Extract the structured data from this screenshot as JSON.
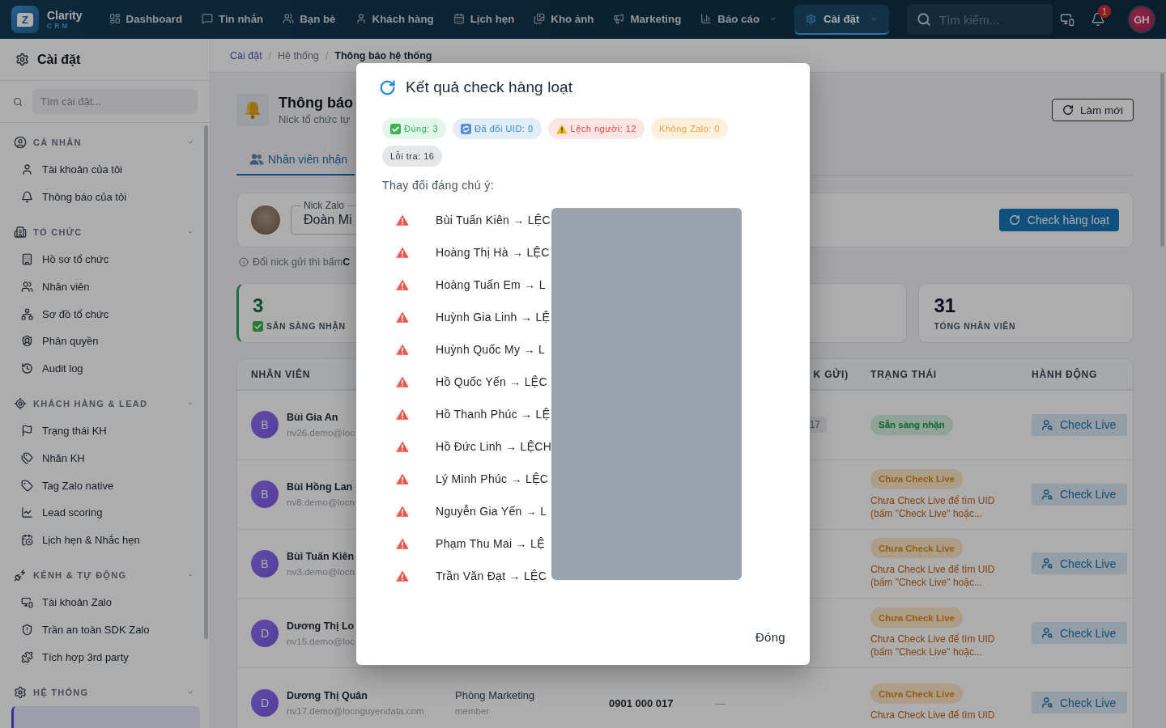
{
  "topbar": {
    "logo": {
      "mark": "Z",
      "name": "Clarity",
      "tagline": "CRM"
    },
    "nav": [
      {
        "label": "Dashboard",
        "selected": false,
        "has_menu": false
      },
      {
        "label": "Tin nhắn",
        "selected": false,
        "has_menu": false
      },
      {
        "label": "Bạn bè",
        "selected": false,
        "has_menu": false
      },
      {
        "label": "Khách hàng",
        "selected": false,
        "has_menu": false
      },
      {
        "label": "Lịch hẹn",
        "selected": false,
        "has_menu": false
      },
      {
        "label": "Kho ảnh",
        "selected": false,
        "has_menu": false
      },
      {
        "label": "Marketing",
        "selected": false,
        "has_menu": false
      },
      {
        "label": "Báo cáo",
        "selected": false,
        "has_menu": true
      },
      {
        "label": "Cài đặt",
        "selected": true,
        "has_menu": true
      }
    ],
    "search": {
      "placeholder": "Tìm kiếm..."
    },
    "notifications": {
      "badge": "1"
    },
    "avatar": {
      "initials": "GH"
    }
  },
  "sidebar": {
    "title": "Cài đặt",
    "search": {
      "placeholder": "Tìm cài đặt..."
    },
    "groups": [
      {
        "label": "CÁ NHÂN",
        "expanded": true,
        "items": [
          {
            "label": "Tài khoản của tôi",
            "selected": false
          },
          {
            "label": "Thông báo của tôi",
            "selected": false
          }
        ]
      },
      {
        "label": "TỔ CHỨC",
        "expanded": true,
        "items": [
          {
            "label": "Hồ sơ tổ chức",
            "selected": false
          },
          {
            "label": "Nhân viên",
            "selected": false
          },
          {
            "label": "Sơ đồ tổ chức",
            "selected": false
          },
          {
            "label": "Phân quyền",
            "selected": false
          },
          {
            "label": "Audit log",
            "selected": false
          }
        ]
      },
      {
        "label": "KHÁCH HÀNG & LEAD",
        "expanded": true,
        "items": [
          {
            "label": "Trạng thái KH",
            "selected": false
          },
          {
            "label": "Nhãn KH",
            "selected": false
          },
          {
            "label": "Tag Zalo native",
            "selected": false
          },
          {
            "label": "Lead scoring",
            "selected": false
          },
          {
            "label": "Lịch hẹn & Nhắc hẹn",
            "selected": false
          }
        ]
      },
      {
        "label": "KÊNH & TỰ ĐỘNG",
        "expanded": true,
        "items": [
          {
            "label": "Tài khoản Zalo",
            "selected": false
          },
          {
            "label": "Trần an toàn SDK Zalo",
            "selected": false
          },
          {
            "label": "Tích hợp 3rd party",
            "selected": false
          }
        ]
      },
      {
        "label": "HỆ THỐNG",
        "expanded": true,
        "items": [
          {
            "selected": true
          }
        ]
      }
    ]
  },
  "breadcrumb": [
    {
      "label": "Cài đặt",
      "kind": "link"
    },
    {
      "label": "/",
      "kind": "separator"
    },
    {
      "label": "Hệ thống",
      "kind": "crumb"
    },
    {
      "label": "/",
      "kind": "separator"
    },
    {
      "label": "Thông báo hệ thống",
      "kind": "current"
    }
  ],
  "page_header": {
    "title": "Thông báo",
    "subtitle": "Nick tổ chức tự",
    "refresh_button": "Làm mới"
  },
  "tabs": [
    {
      "label": "Nhân viên nhận",
      "selected": true
    }
  ],
  "sender_card": {
    "field_label": "Nick Zalo",
    "field_value": "Đoàn Mi",
    "check_button": "Check hàng loạt"
  },
  "hint": "Đổi nick gửi thì bấm**C**",
  "stat_cards": [
    {
      "kind": "ready",
      "value": "3",
      "label": "SẴN SÀNG NHẬN"
    },
    {
      "kind": "covered"
    },
    {
      "kind": "total",
      "value": "31",
      "label": "TỔNG NHÂN VIÊN"
    }
  ],
  "table": {
    "columns": [
      "NHÂN VIÊN",
      null,
      null,
      "K GỬI)",
      "TRẠNG THÁI",
      "HÀNH ĐỘNG"
    ],
    "rows": [
      {
        "avatar": "B",
        "name": "Bùi Gia An",
        "email": "nv26.demo@loc",
        "nick_badge": "17",
        "status": {
          "label": "Sẵn sàng nhận",
          "kind": "ready"
        },
        "action": "Check Live"
      },
      {
        "avatar": "B",
        "name": "Bùi Hồng Lan",
        "email": "nv8.demo@locn",
        "status": {
          "label": "Chưa Check Live",
          "kind": "pending"
        },
        "note": "Chưa Check Live để tìm UID (bấm \"Check Live\" hoặc...",
        "action": "Check Live"
      },
      {
        "avatar": "B",
        "name": "Bùi Tuấn Kiên",
        "email": "nv3.demo@locn",
        "status": {
          "label": "Chưa Check Live",
          "kind": "pending"
        },
        "note": "Chưa Check Live để tìm UID (bấm \"Check Live\" hoặc...",
        "action": "Check Live"
      },
      {
        "avatar": "D",
        "name": "Dương Thị Lo",
        "email": "nv15.demo@loc",
        "status": {
          "label": "Chưa Check Live",
          "kind": "pending"
        },
        "note": "Chưa Check Live để tìm UID (bấm \"Check Live\" hoặc...",
        "action": "Check Live"
      },
      {
        "avatar": "D",
        "name": "Dương Thị Quân",
        "email": "nv17.demo@locnguyendata.com",
        "department": "Phòng Marketing",
        "role": "member",
        "phone": "0901 000 017",
        "nick": "—",
        "status": {
          "label": "Chưa Check Live",
          "kind": "pending"
        },
        "note": "Chưa Check Live để tìm UID",
        "action": "Check Live"
      }
    ]
  },
  "dialog": {
    "title": "Kết quả check hàng loạt",
    "chips": [
      {
        "label": "Đúng: 3",
        "kind": "correct"
      },
      {
        "label": "Đã đổi UID: 0",
        "kind": "changed"
      },
      {
        "label": "Lệch người: 12",
        "kind": "mismatch"
      },
      {
        "label": "Không Zalo: 0",
        "kind": "no_zalo"
      },
      {
        "label": "Lỗi tra: 16",
        "kind": "error"
      }
    ],
    "changes_heading": "Thay đổi đáng chú ý:",
    "changes": [
      "Bùi Tuấn Kiên → LỆC",
      "Hoàng Thị Hà → LỆC",
      "Hoàng Tuấn Em → L",
      "Huỳnh Gia Linh → LỆ",
      "Huỳnh Quốc My → L",
      "Hồ Quốc Yến → LỆC",
      "Hồ Thanh Phúc → LỆ",
      "Hồ Đức Linh → LỆCH",
      "Lý Minh Phúc → LỆC",
      "Nguyễn Gia Yến → L",
      "Phạm Thu Mai → LỆ",
      "Trần Văn Đạt → LỆC"
    ],
    "close_button": "Đóng"
  }
}
